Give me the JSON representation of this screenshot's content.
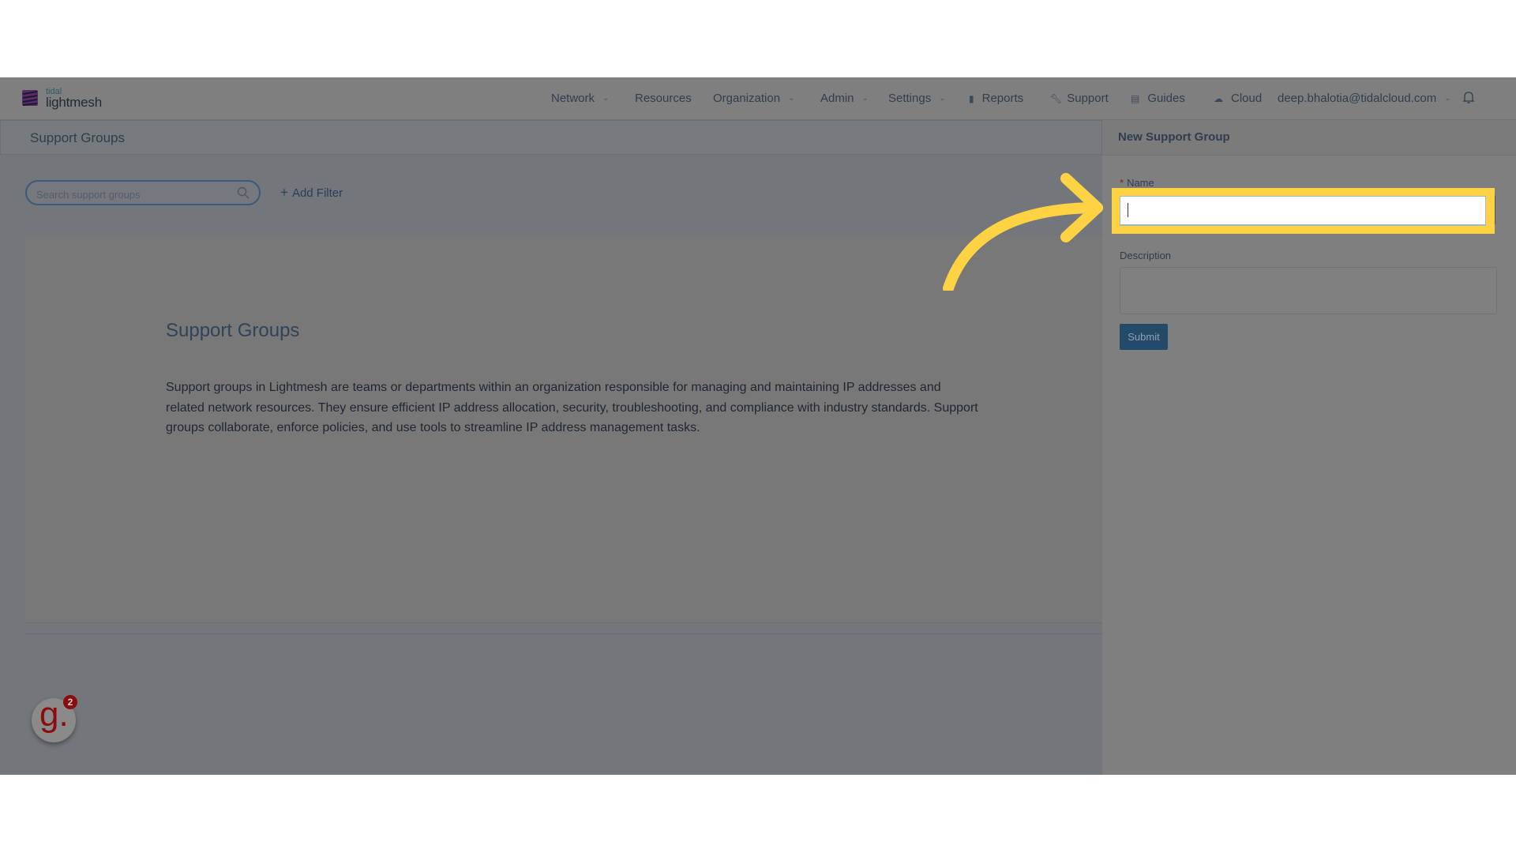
{
  "brand": {
    "top": "tidal",
    "name": "lightmesh"
  },
  "nav": {
    "items": [
      {
        "label": "Network",
        "dropdown": true
      },
      {
        "label": "Resources",
        "dropdown": false
      },
      {
        "label": "Organization",
        "dropdown": true
      },
      {
        "label": "Admin",
        "dropdown": true
      },
      {
        "label": "Settings",
        "dropdown": true
      },
      {
        "label": "Reports",
        "icon": "bar-chart-icon"
      },
      {
        "label": "Support",
        "icon": "wrench-icon"
      },
      {
        "label": "Guides",
        "icon": "book-icon"
      },
      {
        "label": "Cloud",
        "icon": "cloud-icon"
      }
    ],
    "user_email": "deep.bhalotia@tidalcloud.com"
  },
  "page": {
    "title": "Support Groups",
    "search_placeholder": "Search support groups",
    "add_filter_label": "Add Filter",
    "empty_state": {
      "heading": "Support Groups",
      "body": "Support groups in Lightmesh are teams or departments within an organization responsible for managing and maintaining IP addresses and related network resources. They ensure efficient IP address allocation, security, troubleshooting, and compliance with industry standards. Support groups collaborate, enforce policies, and use tools to streamline IP address management tasks."
    }
  },
  "drawer": {
    "title": "New Support Group",
    "name_label": "Name",
    "name_required_mark": "*",
    "name_value": "",
    "description_label": "Description",
    "description_value": "",
    "submit_label": "Submit"
  },
  "widget": {
    "letter": "g.",
    "badge_count": "2"
  },
  "colors": {
    "highlight": "#fed242",
    "brand_purple": "#6a2a7a",
    "primary_button": "#244a6a",
    "required": "#8b1a1a"
  }
}
